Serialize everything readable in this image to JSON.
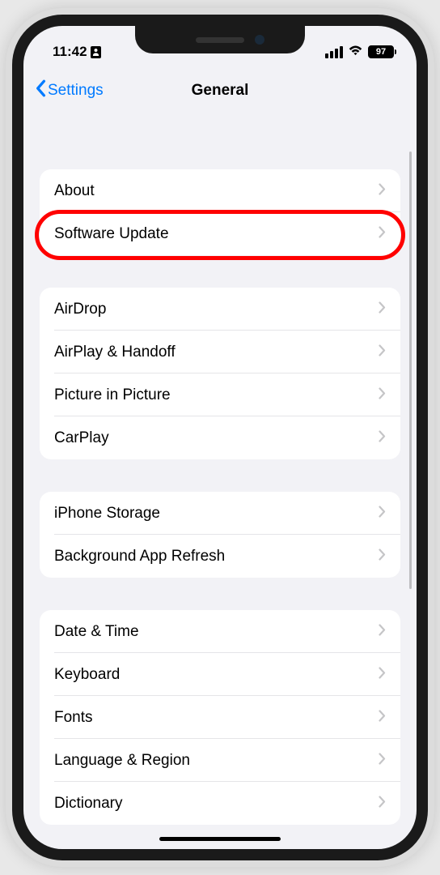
{
  "status": {
    "time": "11:42",
    "battery_pct": "97"
  },
  "nav": {
    "back_label": "Settings",
    "title": "General"
  },
  "sections": [
    {
      "rows": [
        "About",
        "Software Update"
      ]
    },
    {
      "rows": [
        "AirDrop",
        "AirPlay & Handoff",
        "Picture in Picture",
        "CarPlay"
      ]
    },
    {
      "rows": [
        "iPhone Storage",
        "Background App Refresh"
      ]
    },
    {
      "rows": [
        "Date & Time",
        "Keyboard",
        "Fonts",
        "Language & Region",
        "Dictionary"
      ]
    }
  ],
  "highlighted_row": "Software Update"
}
